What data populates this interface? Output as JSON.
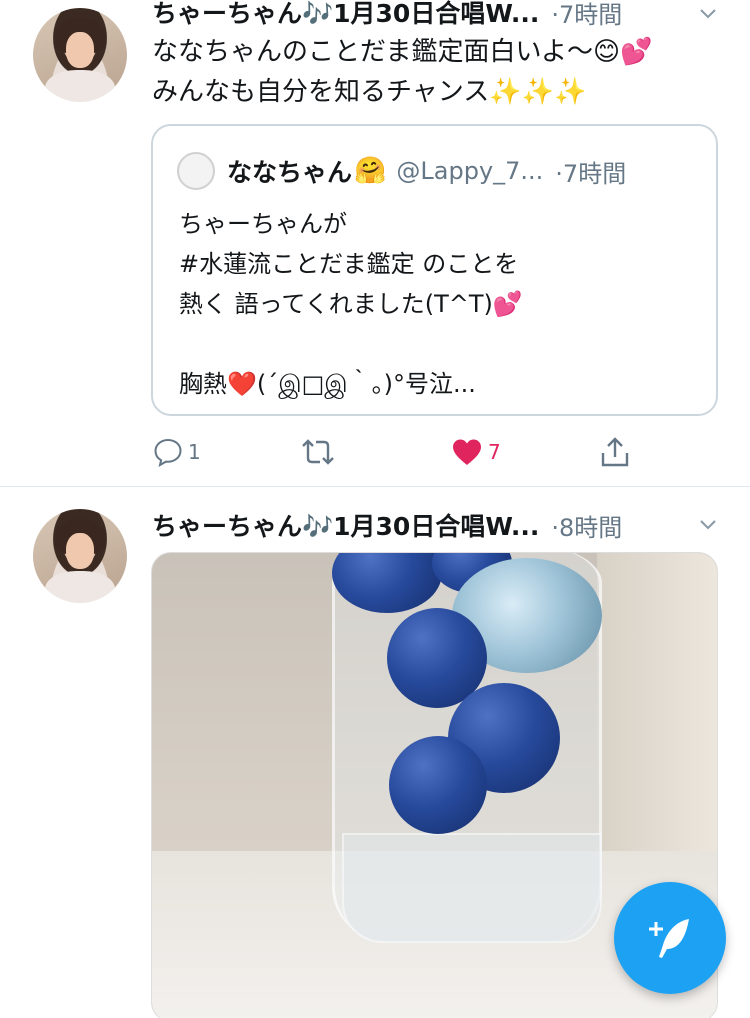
{
  "tweets": [
    {
      "display_name": "ちゃーちゃん🎶1月30日合唱W...",
      "time": "·7時間",
      "text": "ななちゃんのことだま鑑定面白いよ〜😊💕\nみんなも自分を知るチャンス✨✨✨",
      "quote": {
        "name": "ななちゃん",
        "emoji": "🤗",
        "handle": "@Lappy_7...",
        "time": "·7時間",
        "text": "ちゃーちゃんが\n#水蓮流ことだま鑑定 のことを\n熱く 語ってくれました(T^T)💕\n\n胸熱❤️(´இ□இ｀。)°号泣..."
      },
      "actions": {
        "reply_count": "1",
        "like_count": "7"
      }
    },
    {
      "display_name": "ちゃーちゃん🎶1月30日合唱W...",
      "time": "·8時間"
    }
  ],
  "colors": {
    "accent": "#1da1f2",
    "like": "#e0245e",
    "secondary_text": "#657786",
    "border": "#ccd6dd"
  },
  "icons": {
    "reply": "reply-icon",
    "retweet": "retweet-icon",
    "like": "heart-icon",
    "share": "share-icon",
    "menu": "chevron-down-icon",
    "compose": "compose-tweet-icon"
  }
}
